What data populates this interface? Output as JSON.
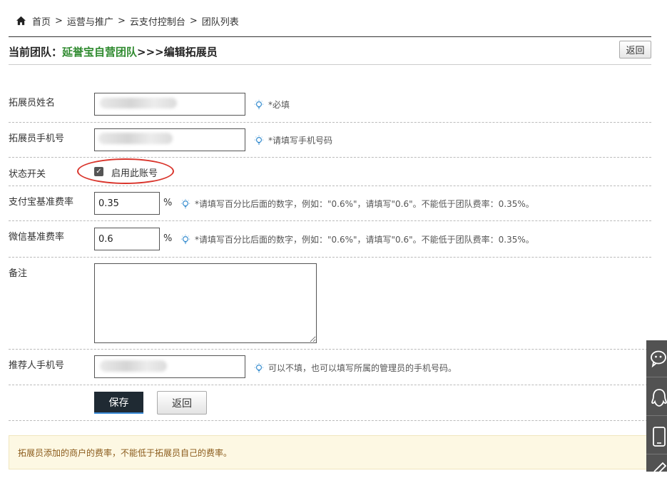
{
  "breadcrumb": {
    "home": "首页",
    "sep": ">",
    "items": [
      "运营与推广",
      "云支付控制台",
      "团队列表"
    ]
  },
  "header": {
    "prefix": "当前团队：",
    "team_name": "延誉宝自营团队",
    "arrows": ">>>",
    "page_title": "编辑拓展员",
    "back_label": "返回"
  },
  "form": {
    "name": {
      "label": "拓展员姓名",
      "value": "",
      "hint": "*必填"
    },
    "phone": {
      "label": "拓展员手机号",
      "value": "",
      "hint": "*请填写手机号码"
    },
    "status": {
      "label": "状态开关",
      "checkbox_label": "启用此账号",
      "checked": true
    },
    "alipay_rate": {
      "label": "支付宝基准费率",
      "value": "0.35",
      "unit": "%",
      "hint": "*请填写百分比后面的数字，例如：\"0.6%\"，请填写\"0.6\"。不能低于团队费率：0.35%。"
    },
    "wechat_rate": {
      "label": "微信基准费率",
      "value": "0.6",
      "unit": "%",
      "hint": "*请填写百分比后面的数字，例如：\"0.6%\"，请填写\"0.6\"。不能低于团队费率：0.35%。"
    },
    "remark": {
      "label": "备注",
      "value": ""
    },
    "referrer_phone": {
      "label": "推荐人手机号",
      "value": "",
      "hint": "可以不填，也可以填写所属的管理员的手机号码。"
    }
  },
  "actions": {
    "save_label": "保存",
    "back_label": "返回"
  },
  "notice": "拓展员添加的商户的费率，不能低于拓展员自己的费率。",
  "sidebar": {
    "icons": [
      "wechat-icon",
      "qq-icon",
      "mobile-icon",
      "edit-icon"
    ]
  },
  "colors": {
    "team": "#2f8a2f",
    "annotation": "#d9342b",
    "save_button": "#1f2a33",
    "notice_bg": "#fdf8e3"
  }
}
